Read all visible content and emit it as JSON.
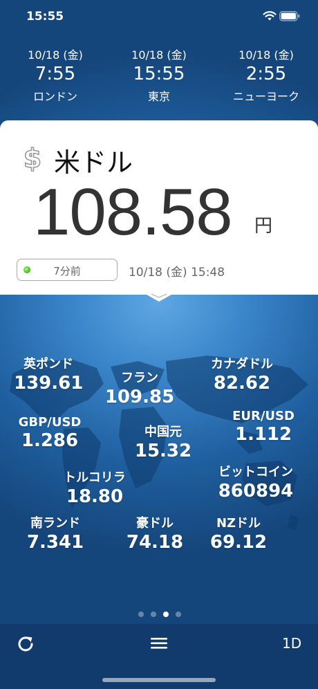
{
  "status_bar": {
    "time": "15:55"
  },
  "clocks": [
    {
      "date": "10/18 (金)",
      "time": "7:55",
      "city": "ロンドン"
    },
    {
      "date": "10/18 (金)",
      "time": "15:55",
      "city": "東京"
    },
    {
      "date": "10/18 (金)",
      "time": "2:55",
      "city": "ニューヨーク"
    }
  ],
  "main_card": {
    "currency_icon": "dollar-sign-icon",
    "currency_name": "米ドル",
    "rate": "108.58",
    "unit": "円",
    "updated_ago": "7分前",
    "timestamp": "10/18 (金) 15:48",
    "status_color": "#3cc41a"
  },
  "rates": [
    {
      "label": "英ポンド",
      "value": "139.61"
    },
    {
      "label": "フラン",
      "value": "109.85"
    },
    {
      "label": "カナダドル",
      "value": "82.62"
    },
    {
      "label": "GBP/USD",
      "value": "1.286"
    },
    {
      "label": "中国元",
      "value": "15.32"
    },
    {
      "label": "EUR/USD",
      "value": "1.112"
    },
    {
      "label": "トルコリラ",
      "value": "18.80"
    },
    {
      "label": "ビットコイン",
      "value": "860894"
    },
    {
      "label": "南ランド",
      "value": "7.341"
    },
    {
      "label": "豪ドル",
      "value": "74.18"
    },
    {
      "label": "NZドル",
      "value": "69.12"
    }
  ],
  "page_indicator": {
    "current": 3,
    "total": 4
  },
  "toolbar": {
    "refresh_icon": "refresh-icon",
    "menu_icon": "hamburger-menu-icon",
    "period_label": "1D"
  },
  "colors": {
    "background": "#3a85c9",
    "card": "#ffffff",
    "accent_green": "#3cc41a"
  }
}
